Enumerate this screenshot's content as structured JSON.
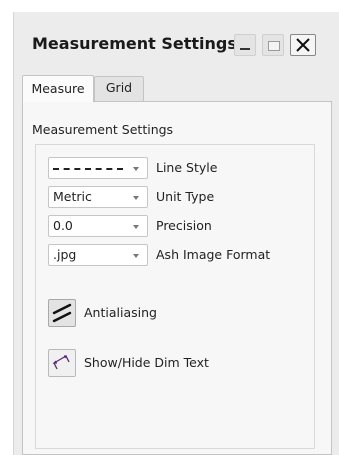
{
  "window": {
    "title": "Measurement Settings",
    "controls": {
      "minimize": "minimize",
      "maximize": "maximize",
      "close": "close"
    }
  },
  "tabs": [
    {
      "label": "Measure",
      "active": true
    },
    {
      "label": "Grid",
      "active": false
    }
  ],
  "section": {
    "label": "Measurement Settings"
  },
  "settings": [
    {
      "value": "",
      "label": "Line Style",
      "value_style": "dashed-line"
    },
    {
      "value": "Metric",
      "label": "Unit Type"
    },
    {
      "value": "0.0",
      "label": "Precision"
    },
    {
      "value": ".jpg",
      "label": "Ash Image Format"
    }
  ],
  "tools": [
    {
      "label": "Antialiasing",
      "icon": "antialiasing-icon",
      "pressed": true
    },
    {
      "label": "Show/Hide Dim Text",
      "icon": "dimension-text-icon",
      "pressed": false
    }
  ],
  "colors": {
    "dim_icon": "#5a2a7a",
    "window_bg": "#ececec",
    "panel_bg": "#f7f7f7"
  }
}
